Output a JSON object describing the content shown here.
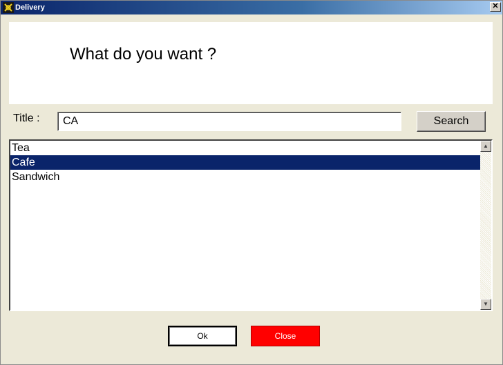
{
  "window": {
    "title": "Delivery",
    "close_glyph": "✕",
    "icon": "delivery-app-icon"
  },
  "header": {
    "prompt": "What do you want ?"
  },
  "search": {
    "label": "Title :",
    "value": "CA",
    "button_label": "Search"
  },
  "list": {
    "items": [
      {
        "label": "Tea",
        "selected": false
      },
      {
        "label": "Cafe",
        "selected": true
      },
      {
        "label": "Sandwich",
        "selected": false
      }
    ],
    "scroll_up_glyph": "▲",
    "scroll_down_glyph": "▼"
  },
  "actions": {
    "ok_label": "Ok",
    "close_label": "Close"
  },
  "colors": {
    "selection": "#0a246a",
    "close_button": "#ff0000"
  }
}
